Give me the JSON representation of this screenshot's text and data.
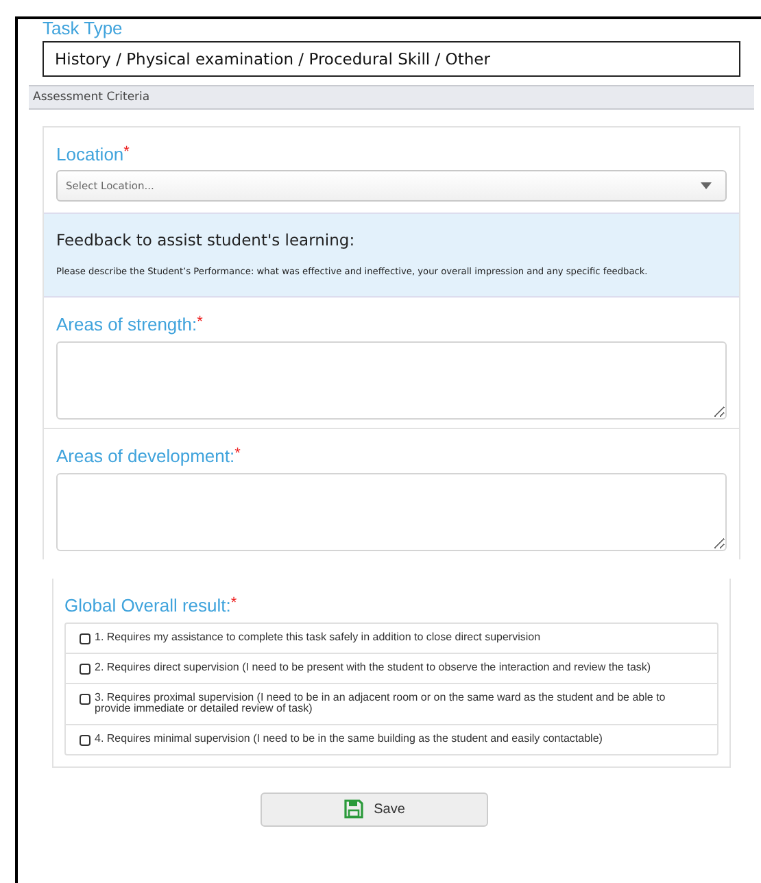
{
  "task_type": {
    "label": "Task Type",
    "value": "History / Physical examination / Procedural Skill / Other"
  },
  "section_title": "Assessment Criteria",
  "location": {
    "label": "Location",
    "required_mark": "*",
    "placeholder": "Select Location..."
  },
  "feedback": {
    "title": "Feedback to assist student's learning:",
    "description": "Please describe the Student’s Performance: what was effective and ineffective, your overall impression and any specific feedback."
  },
  "text_areas": [
    {
      "label": "Areas of strength:",
      "required_mark": "*"
    },
    {
      "label": "Areas of development:",
      "required_mark": "*"
    }
  ],
  "global_result": {
    "label": "Global Overall result:",
    "required_mark": "*",
    "options": [
      {
        "label": "1. Requires my assistance to complete this task safely in addition to close direct supervision",
        "checked": false
      },
      {
        "label": "2. Requires direct supervision (I need to be present with the student to observe the interaction and review the task)",
        "checked": false
      },
      {
        "label": "3. Requires proximal supervision (I need to be in an adjacent room or on the same ward as the student and be able to provide immediate or detailed review of task)",
        "checked": false
      },
      {
        "label": "4. Requires minimal supervision (I need to be in the same building as the student and easily contactable)",
        "checked": false
      }
    ]
  },
  "save_button": "Save"
}
